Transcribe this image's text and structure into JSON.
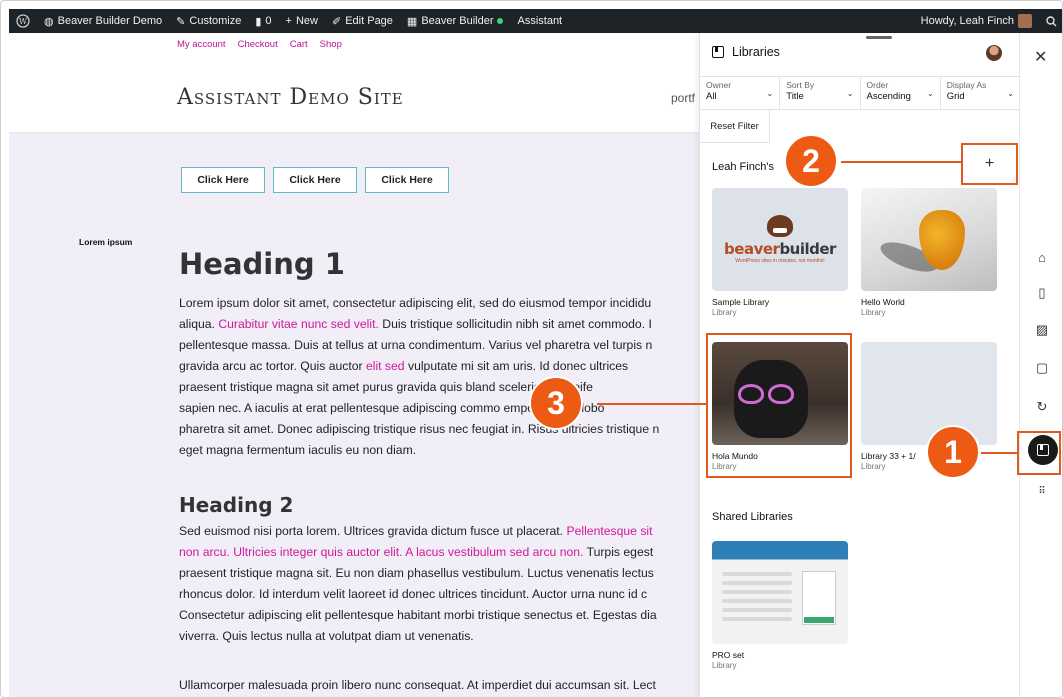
{
  "adminbar": {
    "site_name": "Beaver Builder Demo",
    "customize": "Customize",
    "comments_count": "0",
    "new": "New",
    "edit_page": "Edit Page",
    "beaver_builder": "Beaver Builder",
    "assistant": "Assistant",
    "howdy": "Howdy, Leah Finch"
  },
  "site": {
    "topnav": [
      "My account",
      "Checkout",
      "Cart",
      "Shop"
    ],
    "title": "Assistant Demo Site",
    "nav_partial": "portf",
    "buttons": [
      "Click Here",
      "Click Here",
      "Click Here"
    ],
    "sidebar_label": "Lorem ipsum",
    "heading1": "Heading 1",
    "para1": {
      "l1": "Lorem ipsum dolor sit amet, consectetur adipiscing elit, sed do eiusmod tempor incididu",
      "l2a": "aliqua. ",
      "l2link": "Curabitur vitae nunc sed velit.",
      "l2b": " Duis tristique sollicitudin nibh sit amet commodo. I",
      "l3": "pellentesque massa. Duis at tellus at urna condimentum. Varius vel pharetra vel turpis n",
      "l4a": "gravida arcu ac tortor. Quis auctor ",
      "l4link": "elit sed",
      "l4b": " vulputate mi sit am        uris. Id donec ultrices",
      "l5": "praesent tristique magna sit amet purus gravida quis bland        scelerisque eleife",
      "l6": "sapien nec. A iaculis at erat pellentesque adipiscing commo        empor orci eu lobo",
      "l7": "pharetra sit amet. Donec adipiscing tristique risus nec feugiat in. Risus ultricies tristique n",
      "l8": "eget magna fermentum iaculis eu non diam."
    },
    "heading2": "Heading 2",
    "para2": {
      "l1a": "Sed euismod nisi porta lorem. Ultrices gravida dictum fusce ut placerat. ",
      "l1link": "Pellentesque sit",
      "l2link": "non arcu. Ultricies integer quis auctor elit. A lacus vestibulum sed arcu non.",
      "l2b": " Turpis egest",
      "l3": "praesent tristique magna sit. Eu non diam phasellus vestibulum. Luctus venenatis lectus",
      "l4": "rhoncus dolor. Id interdum velit laoreet id donec ultrices tincidunt. Auctor urna nunc id c",
      "l5": "Consectetur adipiscing elit pellentesque habitant morbi tristique senectus et. Egestas dia",
      "l6": "viverra. Quis lectus nulla at volutpat diam ut venenatis."
    },
    "para3": "Ullamcorper malesuada proin libero nunc consequat. At imperdiet dui accumsan sit. Lect"
  },
  "panel": {
    "title": "Libraries",
    "filters": [
      {
        "label": "Owner",
        "value": "All"
      },
      {
        "label": "Sort By",
        "value": "Title"
      },
      {
        "label": "Order",
        "value": "Ascending"
      },
      {
        "label": "Display As",
        "value": "Grid"
      }
    ],
    "reset": "Reset Filter",
    "my_section": "Leah Finch's",
    "add_symbol": "+",
    "cards": [
      {
        "name": "Sample Library",
        "type": "Library"
      },
      {
        "name": "Hello World",
        "type": "Library"
      },
      {
        "name": "Hola Mundo",
        "type": "Library"
      },
      {
        "name": "Library 33 + 1/",
        "type": "Library"
      }
    ],
    "shared_section": "Shared Libraries",
    "shared_cards": [
      {
        "name": "PRO set",
        "type": "Library"
      }
    ],
    "bb_logo_a": "beaver",
    "bb_logo_b": "builder",
    "bb_tagline": "WordPress sites in minutes, not months!"
  },
  "callouts": [
    "1",
    "2",
    "3"
  ],
  "icons": {
    "wp": "wordpress-icon",
    "close": "close-icon",
    "rail": [
      "home-icon",
      "page-icon",
      "image-icon",
      "comment-icon",
      "refresh-icon",
      "libraries-icon",
      "apps-grid-icon"
    ]
  },
  "colors": {
    "accent": "#e05a1e",
    "link": "#d1189a",
    "button_border": "#5fb9c9",
    "content_bg": "#f1eef8"
  }
}
